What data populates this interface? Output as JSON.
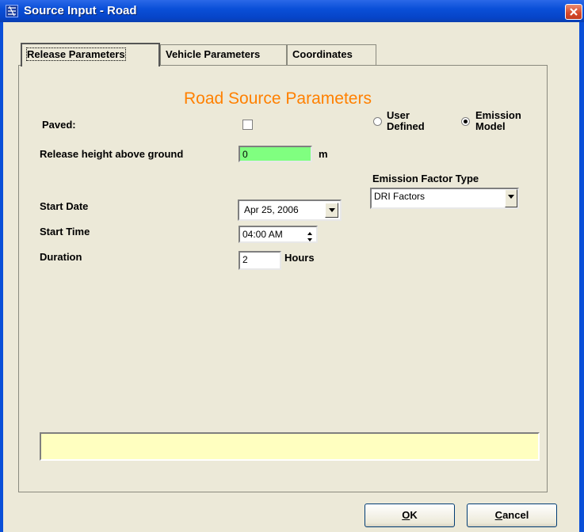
{
  "window": {
    "title": "Source Input - Road"
  },
  "tabs": [
    {
      "label": "Release Parameters",
      "active": true
    },
    {
      "label": "Vehicle Parameters",
      "active": false
    },
    {
      "label": "Coordinates",
      "active": false
    }
  ],
  "panel": {
    "heading": "Road Source Parameters",
    "paved": {
      "label": "Paved:",
      "checked": false
    },
    "release_height": {
      "label": "Release height above ground",
      "value": "0",
      "unit": "m"
    },
    "source_mode": [
      {
        "label_line1": "User",
        "label_line2": "Defined",
        "selected": false
      },
      {
        "label_line1": "Emission",
        "label_line2": "Model",
        "selected": true
      }
    ],
    "emission_factor": {
      "label": "Emission Factor Type",
      "value": "DRI Factors"
    },
    "start_date": {
      "label": "Start Date",
      "value": "Apr 25, 2006"
    },
    "start_time": {
      "label": "Start Time",
      "value": "04:00 AM"
    },
    "duration": {
      "label": "Duration",
      "value": "2",
      "unit": "Hours"
    },
    "status_text": ""
  },
  "buttons": {
    "ok": {
      "mnemonic": "O",
      "rest": "K"
    },
    "cancel": {
      "mnemonic": "C",
      "rest": "ancel"
    }
  },
  "colors": {
    "heading": "#ff8000",
    "height_field": "#80ff80",
    "status_bar": "#ffffc0",
    "titlebar": "#0a4fd8"
  }
}
